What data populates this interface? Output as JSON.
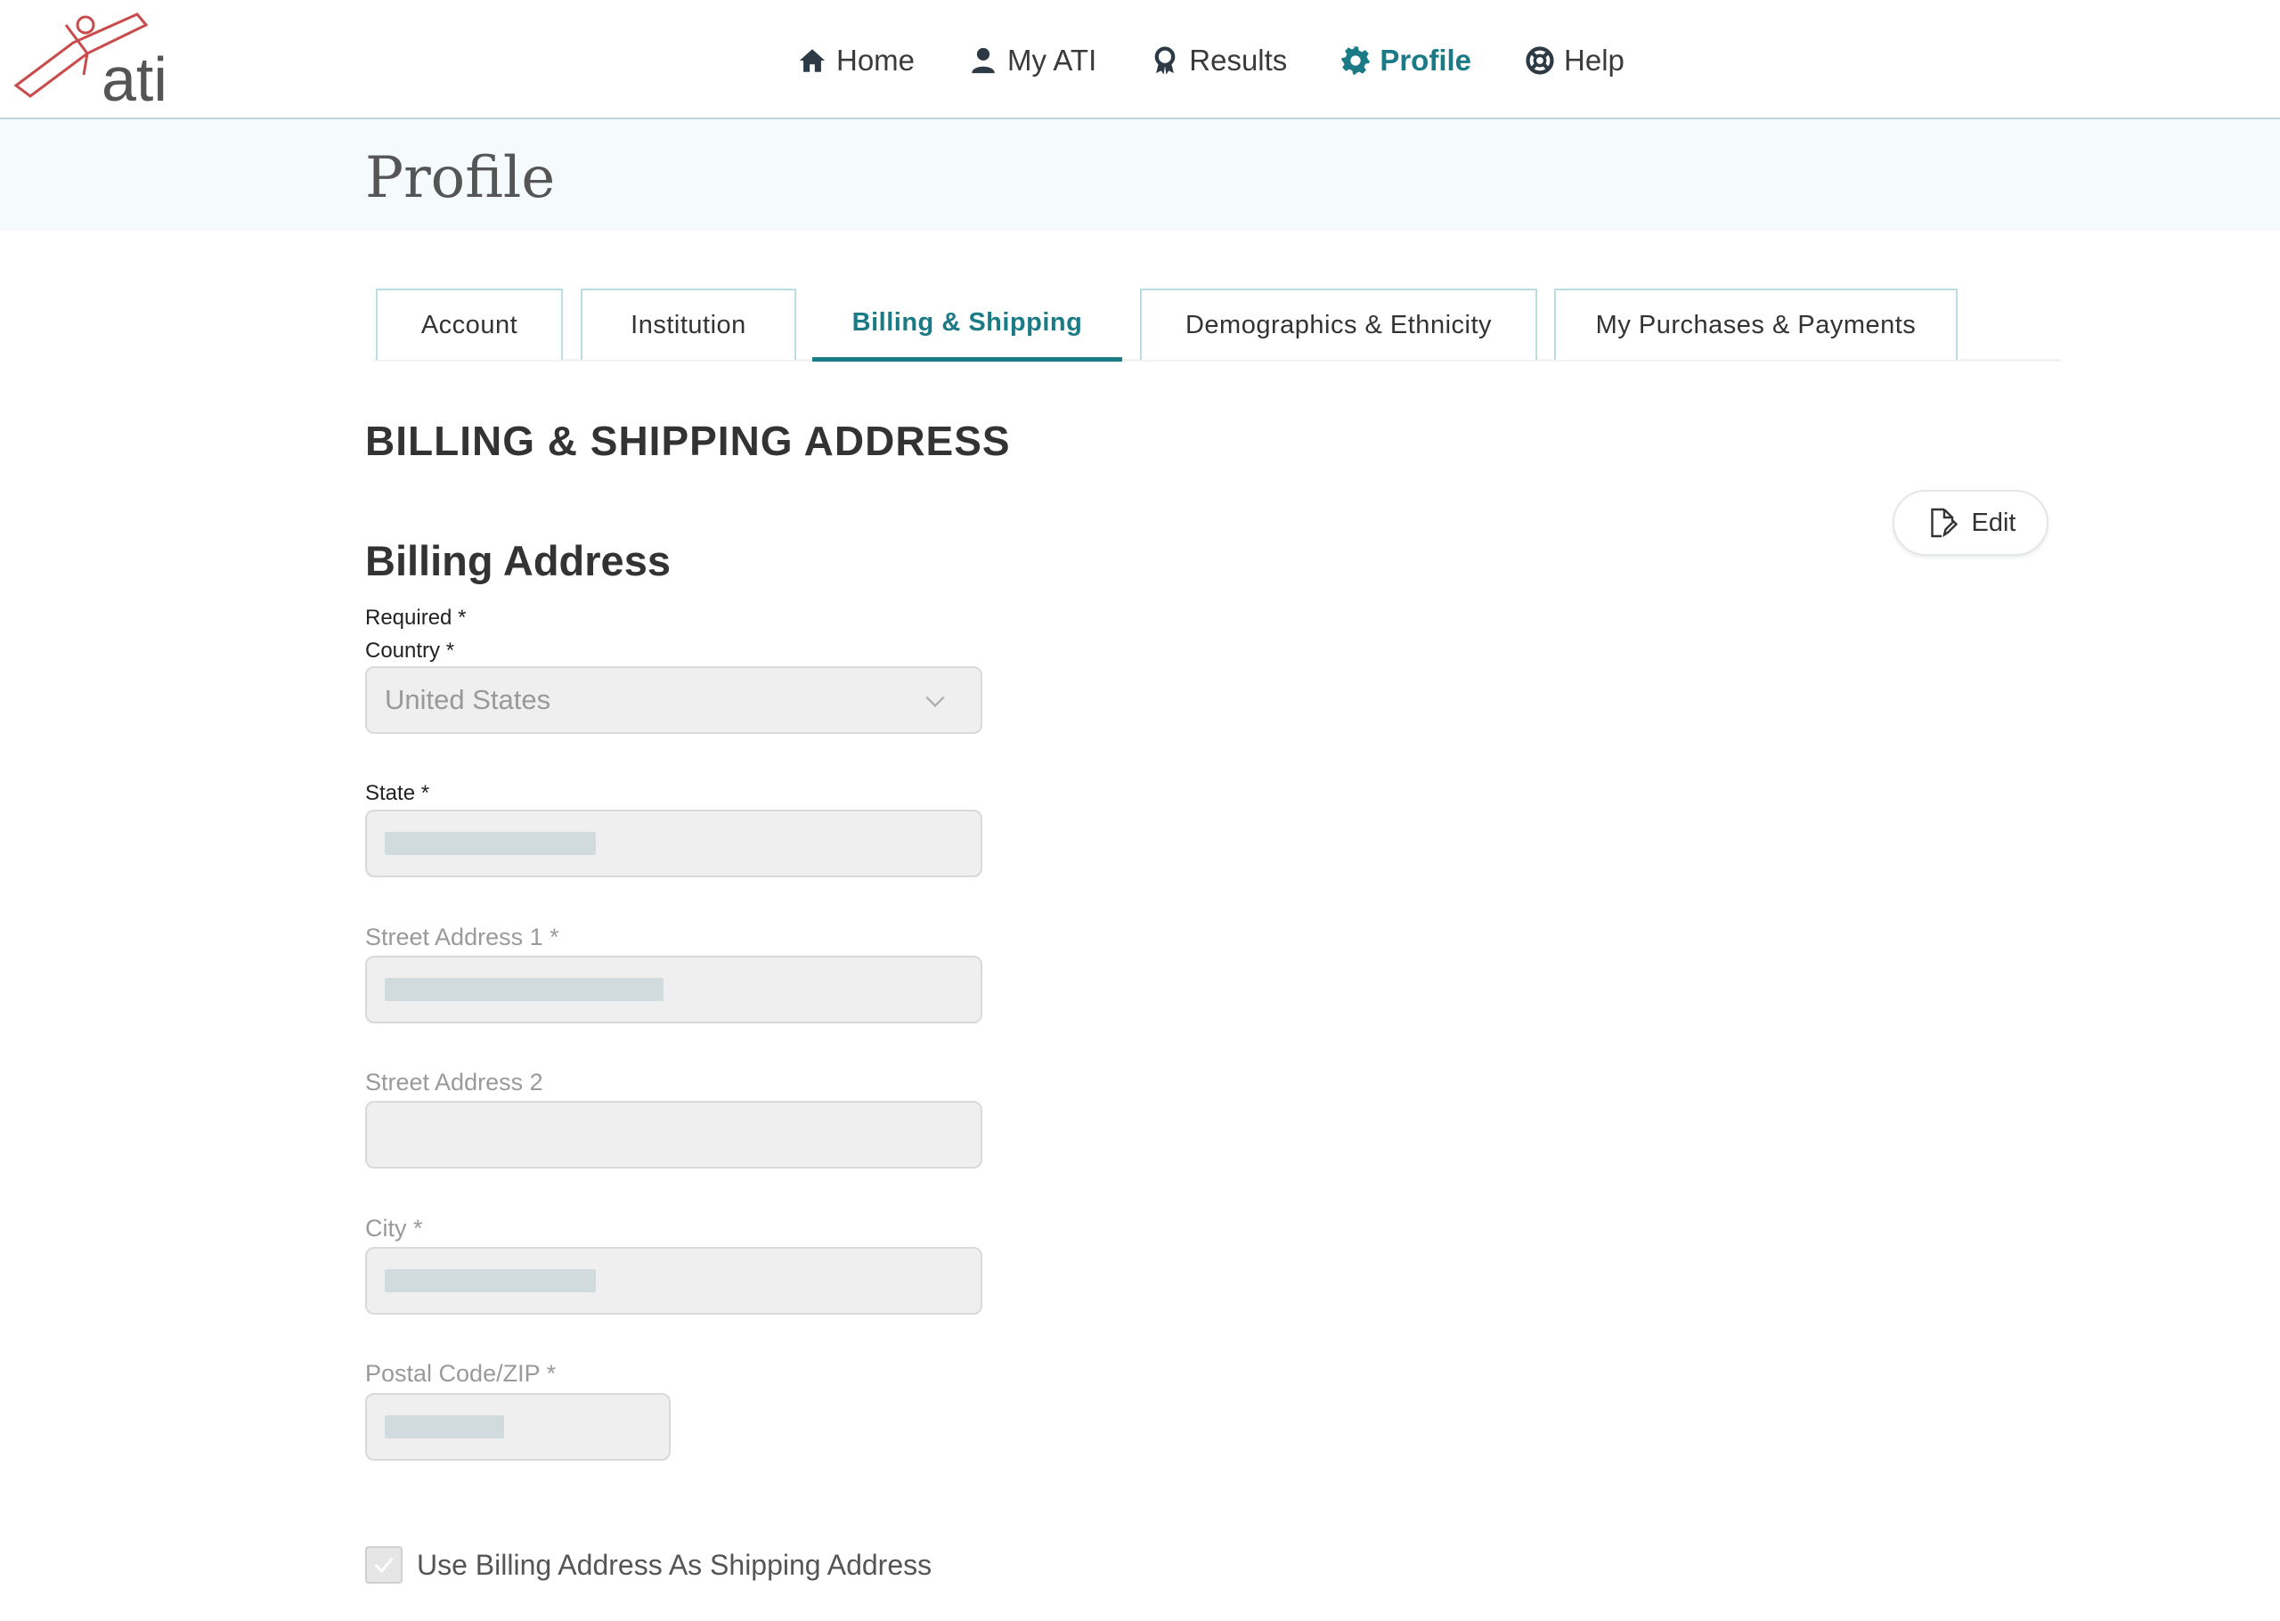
{
  "brand": {
    "logo_text": "ati",
    "accent": "#1a7b86"
  },
  "nav": {
    "items": [
      {
        "label": "Home",
        "icon": "home-icon"
      },
      {
        "label": "My ATI",
        "icon": "user-icon"
      },
      {
        "label": "Results",
        "icon": "award-icon"
      },
      {
        "label": "Profile",
        "icon": "gear-icon",
        "active": true
      },
      {
        "label": "Help",
        "icon": "lifebuoy-icon"
      }
    ]
  },
  "page": {
    "title": "Profile"
  },
  "tabs": [
    {
      "label": "Account"
    },
    {
      "label": "Institution"
    },
    {
      "label": "Billing & Shipping",
      "active": true
    },
    {
      "label": "Demographics & Ethnicity"
    },
    {
      "label": "My Purchases & Payments"
    }
  ],
  "section": {
    "heading": "BILLING & SHIPPING ADDRESS",
    "subheading": "Billing Address",
    "edit_label": "Edit",
    "required_note": "Required *"
  },
  "form": {
    "country": {
      "label": "Country *",
      "value": "United States"
    },
    "state": {
      "label": "State *"
    },
    "street1": {
      "label": "Street Address 1 *"
    },
    "street2": {
      "label": "Street Address 2"
    },
    "city": {
      "label": "City *"
    },
    "zip": {
      "label": "Postal Code/ZIP *"
    },
    "same_as_shipping": {
      "label": "Use Billing Address As Shipping Address",
      "checked": true
    }
  }
}
